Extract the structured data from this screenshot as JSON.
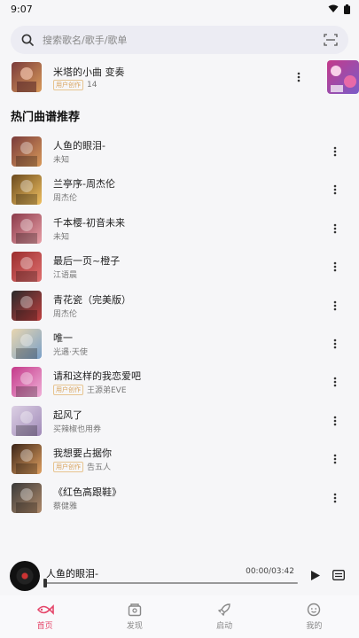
{
  "status_bar": {
    "time": "9:07"
  },
  "search": {
    "placeholder": "搜索歌名/歌手/歌单"
  },
  "top_item": {
    "title": "米塔的小曲 变奏",
    "badge": "用户创作",
    "count": "14"
  },
  "section": {
    "title": "热门曲谱推荐"
  },
  "songs": [
    {
      "title": "人鱼的眼泪-",
      "artist": "未知",
      "badge": "",
      "thumb": [
        "#7a3b3b",
        "#d99a5a"
      ]
    },
    {
      "title": "兰亭序-周杰伦",
      "artist": "周杰伦",
      "badge": "",
      "thumb": [
        "#6b4a1e",
        "#f0c060"
      ]
    },
    {
      "title": "千本樱-初音未来",
      "artist": "未知",
      "badge": "",
      "thumb": [
        "#8b3a4a",
        "#e9a0a8"
      ]
    },
    {
      "title": "最后一页~橙子",
      "artist": "江语晨",
      "badge": "",
      "thumb": [
        "#9b2d2d",
        "#e07070"
      ]
    },
    {
      "title": "青花瓷（完美版）",
      "artist": "周杰伦",
      "badge": "",
      "thumb": [
        "#2a2a2a",
        "#c04040"
      ]
    },
    {
      "title": "唯一",
      "artist": "光遇·天使",
      "badge": "",
      "thumb": [
        "#e8d6b0",
        "#7aa0c8"
      ]
    },
    {
      "title": "请和这样的我恋爱吧",
      "artist": "王源弟EVE",
      "badge": "用户创作",
      "thumb": [
        "#c43a8a",
        "#f0b0d8"
      ]
    },
    {
      "title": "起风了",
      "artist": "买辣椒也用券",
      "badge": "",
      "thumb": [
        "#dcd0e4",
        "#a08ab8"
      ]
    },
    {
      "title": "我想要占据你",
      "artist": "告五人",
      "badge": "用户创作",
      "thumb": [
        "#3a2418",
        "#e0a060"
      ]
    },
    {
      "title": "《红色高跟鞋》",
      "artist": "蔡健雅",
      "badge": "",
      "thumb": [
        "#3a3a3a",
        "#b08a6a"
      ]
    }
  ],
  "player": {
    "title": "人鱼的眼泪-",
    "time": "00:00/03:42",
    "progress": 0.0
  },
  "tabs": [
    {
      "label": "首页",
      "icon": "home-fish-icon",
      "active": true
    },
    {
      "label": "发现",
      "icon": "discover-icon",
      "active": false
    },
    {
      "label": "启动",
      "icon": "rocket-icon",
      "active": false
    },
    {
      "label": "我的",
      "icon": "profile-face-icon",
      "active": false
    }
  ],
  "colors": {
    "accent": "#e5466a",
    "badge": "#d8a35c",
    "background": "#f6f6f8"
  }
}
